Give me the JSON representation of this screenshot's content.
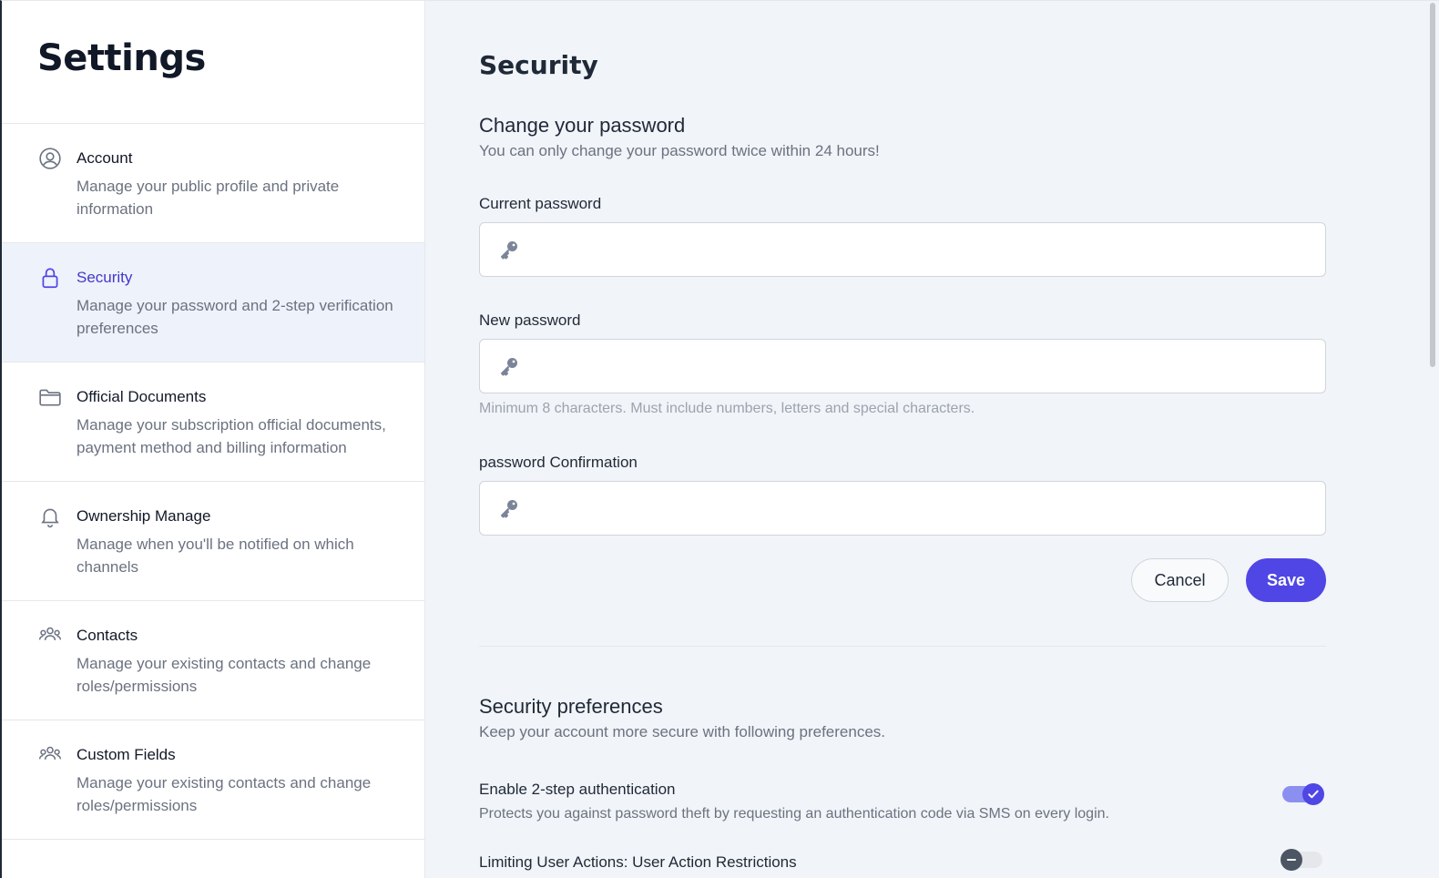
{
  "sidebar": {
    "title": "Settings",
    "items": [
      {
        "label": "Account",
        "desc": "Manage your public profile and private information",
        "icon": "user-circle-icon"
      },
      {
        "label": "Security",
        "desc": "Manage your password and 2-step verification preferences",
        "icon": "lock-icon",
        "active": true
      },
      {
        "label": "Official Documents",
        "desc": "Manage your subscription official documents, payment method and billing information",
        "icon": "folder-icon"
      },
      {
        "label": "Ownership Manage",
        "desc": "Manage when you'll be notified on which channels",
        "icon": "bell-icon"
      },
      {
        "label": "Contacts",
        "desc": "Manage your existing contacts and change roles/permissions",
        "icon": "users-icon"
      },
      {
        "label": "Custom Fields",
        "desc": "Manage your existing contacts and change roles/permissions",
        "icon": "users-icon"
      }
    ]
  },
  "main": {
    "title": "Security",
    "password": {
      "title": "Change your password",
      "subtitle": "You can only change your password twice within 24 hours!",
      "current_label": "Current password",
      "current_value": "",
      "new_label": "New password",
      "new_value": "",
      "new_hint": "Minimum 8 characters. Must include numbers, letters and special characters.",
      "confirm_label": "password Confirmation",
      "confirm_value": "",
      "cancel": "Cancel",
      "save": "Save"
    },
    "prefs": {
      "title": "Security preferences",
      "subtitle": "Keep your account more secure with following preferences.",
      "items": [
        {
          "label": "Enable 2-step authentication",
          "desc": "Protects you against password theft by requesting an authentication code via SMS on every login.",
          "enabled": true
        },
        {
          "label": "Limiting User Actions: User Action Restrictions",
          "desc": "",
          "enabled": false
        }
      ]
    }
  },
  "colors": {
    "accent": "#4f46e5",
    "active_bg": "#eef2fb",
    "main_bg": "#f1f4f8"
  }
}
